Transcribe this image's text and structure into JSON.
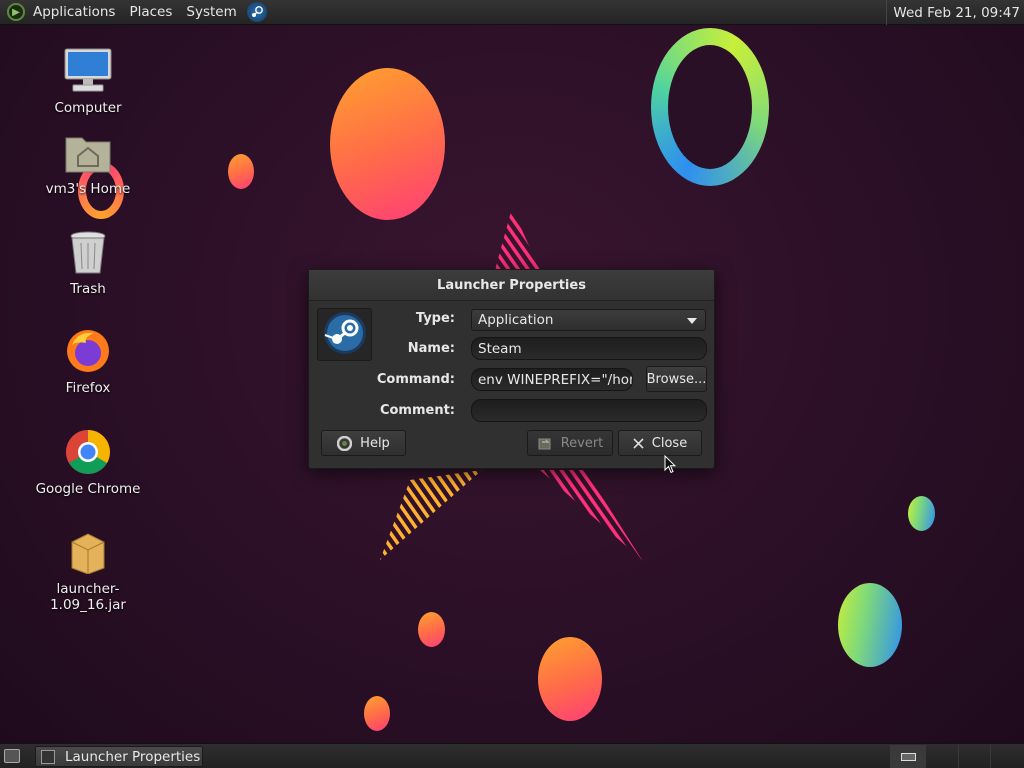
{
  "top_panel": {
    "menus": [
      "Applications",
      "Places",
      "System"
    ],
    "clock": "Wed Feb 21, 09:47"
  },
  "desktop_icons": [
    {
      "label": "Computer",
      "icon": "computer-icon"
    },
    {
      "label": "vm3's Home",
      "icon": "home-folder-icon"
    },
    {
      "label": "Trash",
      "icon": "trash-icon"
    },
    {
      "label": "Firefox",
      "icon": "firefox-icon"
    },
    {
      "label": "Google Chrome",
      "icon": "chrome-icon"
    },
    {
      "label": "launcher-1.09_16.jar",
      "icon": "jar-package-icon"
    }
  ],
  "dialog": {
    "title": "Launcher Properties",
    "app_icon": "steam-icon",
    "type_label": "Type:",
    "type_value": "Application",
    "name_label": "Name:",
    "name_value": "Steam",
    "command_label": "Command:",
    "command_value": "env WINEPREFIX=\"/hom",
    "comment_label": "Comment:",
    "comment_value": "",
    "browse_label": "Browse...",
    "help_label": "Help",
    "revert_label": "Revert",
    "close_label": "Close"
  },
  "bottom_panel": {
    "task_label": "Launcher Properties"
  },
  "colors": {
    "wallpaper": "#2a0f26",
    "panel": "#2a2a2a",
    "dialog_bg": "#303030"
  }
}
